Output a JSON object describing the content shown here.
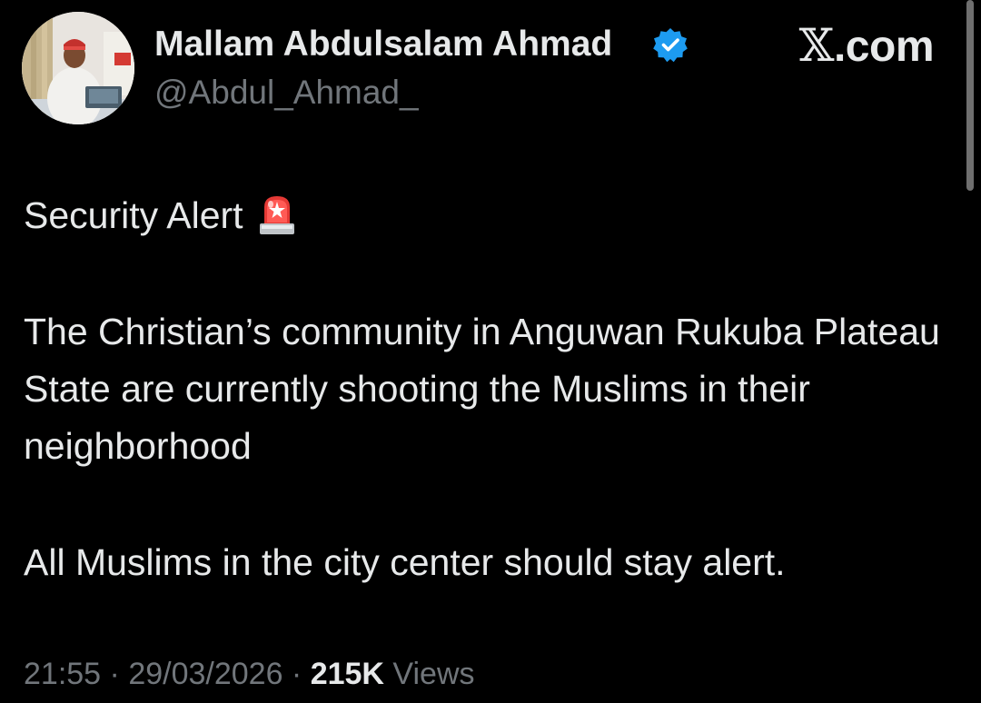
{
  "account": {
    "display_name": "Mallam Abdulsalam Ahmad",
    "handle": "@Abdul_Ahmad_",
    "verified_icon": "verified-badge-icon",
    "avatar_icon": "profile-photo"
  },
  "brand": {
    "logo_text": "𝕏",
    "domain_text": ".com"
  },
  "post": {
    "alert_text": "Security Alert",
    "alert_icon": "siren-icon",
    "paragraph_1": "The Christian’s community in Anguwan Rukuba Plateau State are currently shooting the Muslims in their neighborhood",
    "paragraph_2": "All Muslims in the city center should stay alert."
  },
  "meta": {
    "time": "21:55",
    "separator": " · ",
    "date": "29/03/2026",
    "views_count": "215K",
    "views_label": " Views"
  },
  "colors": {
    "background": "#000000",
    "primary_text": "#e7e9ea",
    "secondary_text": "#71767b",
    "verified_blue": "#1d9bf0"
  }
}
